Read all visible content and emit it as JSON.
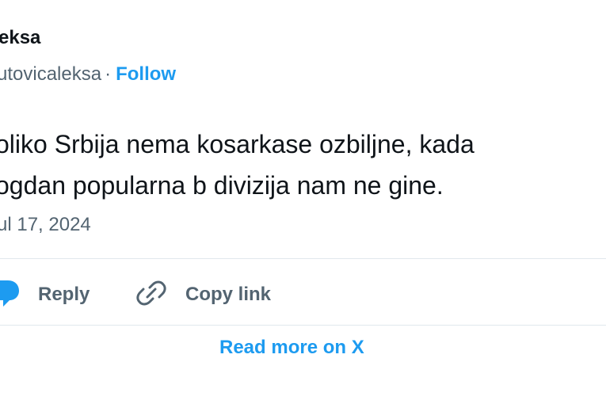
{
  "tweet": {
    "author_name": "eksa",
    "handle": "utovicaleksa",
    "separator": "·",
    "follow_label": "Follow",
    "text_line_1": "oliko Srbija nema kosarkase ozbiljne, kada",
    "text_line_2": "ogdan popularna b divizija nam ne gine.",
    "date": "ul 17, 2024"
  },
  "actions": {
    "reply_label": "Reply",
    "copy_link_label": "Copy link",
    "read_more_label": "Read more on X"
  },
  "icons": {
    "reply": "reply-bubble-icon",
    "copy_link": "link-icon"
  },
  "colors": {
    "accent": "#1d9bf0",
    "text_primary": "#0f1419",
    "text_secondary": "#536471",
    "divider": "#e1e8ed"
  }
}
